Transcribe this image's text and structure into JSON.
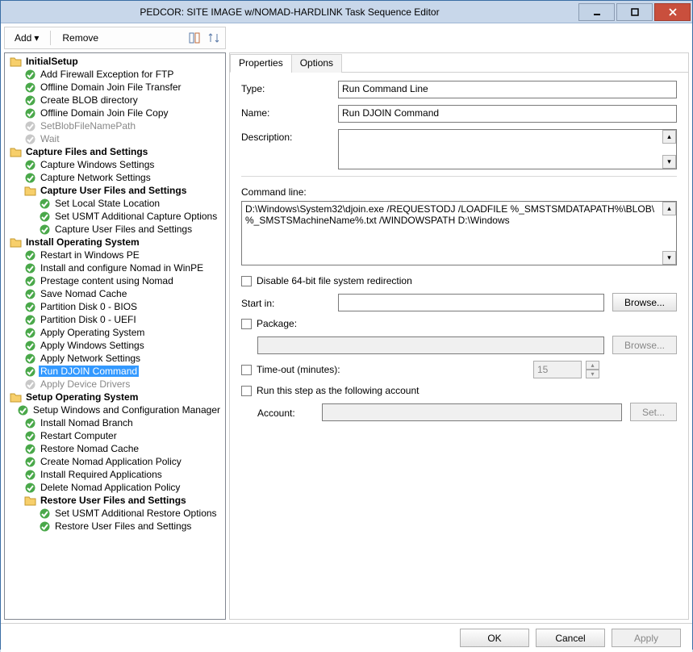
{
  "title": "PEDCOR: SITE IMAGE w/NOMAD-HARDLINK Task Sequence Editor",
  "toolbar": {
    "add": "Add",
    "remove": "Remove"
  },
  "tabs": {
    "properties": "Properties",
    "options": "Options"
  },
  "labels": {
    "type": "Type:",
    "name": "Name:",
    "description": "Description:",
    "cmdline": "Command line:",
    "disable64": "Disable 64-bit file system redirection",
    "startin": "Start in:",
    "package": "Package:",
    "timeout": "Time-out (minutes):",
    "runas": "Run this step as the following account",
    "account": "Account:",
    "browse": "Browse...",
    "set": "Set...",
    "ok": "OK",
    "cancel": "Cancel",
    "apply": "Apply"
  },
  "values": {
    "type": "Run Command Line",
    "name": "Run DJOIN Command",
    "description": "",
    "cmdline": "D:\\Windows\\System32\\djoin.exe /REQUESTODJ /LOADFILE %_SMSTSMDATAPATH%\\BLOB\\%_SMSTSMachineName%.txt /WINDOWSPATH D:\\Windows",
    "startin": "",
    "package": "",
    "timeout": "15",
    "account": ""
  },
  "tree": [
    {
      "d": 0,
      "t": "folder",
      "b": 1,
      "l": "InitialSetup"
    },
    {
      "d": 1,
      "t": "ok",
      "l": "Add Firewall Exception for FTP"
    },
    {
      "d": 1,
      "t": "ok",
      "l": "Offline Domain Join File Transfer"
    },
    {
      "d": 1,
      "t": "ok",
      "l": "Create BLOB directory"
    },
    {
      "d": 1,
      "t": "ok",
      "l": "Offline Domain Join File Copy"
    },
    {
      "d": 1,
      "t": "dis",
      "g": 1,
      "l": "SetBlobFileNamePath"
    },
    {
      "d": 1,
      "t": "dis",
      "g": 1,
      "l": "Wait"
    },
    {
      "d": 0,
      "t": "folder",
      "b": 1,
      "l": "Capture Files and Settings"
    },
    {
      "d": 1,
      "t": "ok",
      "l": "Capture Windows Settings"
    },
    {
      "d": 1,
      "t": "ok",
      "l": "Capture Network Settings"
    },
    {
      "d": 1,
      "t": "folder",
      "b": 1,
      "l": "Capture User Files and Settings"
    },
    {
      "d": 2,
      "t": "ok",
      "l": "Set Local State Location"
    },
    {
      "d": 2,
      "t": "ok",
      "l": "Set USMT Additional Capture Options"
    },
    {
      "d": 2,
      "t": "ok",
      "l": "Capture User Files and Settings"
    },
    {
      "d": 0,
      "t": "folder",
      "b": 1,
      "l": "Install Operating System"
    },
    {
      "d": 1,
      "t": "ok",
      "l": "Restart in Windows PE"
    },
    {
      "d": 1,
      "t": "ok",
      "l": "Install and configure Nomad in WinPE"
    },
    {
      "d": 1,
      "t": "ok",
      "l": "Prestage content using Nomad"
    },
    {
      "d": 1,
      "t": "ok",
      "l": "Save Nomad Cache"
    },
    {
      "d": 1,
      "t": "ok",
      "l": "Partition Disk 0 - BIOS"
    },
    {
      "d": 1,
      "t": "ok",
      "l": "Partition Disk 0 - UEFI"
    },
    {
      "d": 1,
      "t": "ok",
      "l": "Apply Operating System"
    },
    {
      "d": 1,
      "t": "ok",
      "l": "Apply Windows Settings"
    },
    {
      "d": 1,
      "t": "ok",
      "l": "Apply Network Settings"
    },
    {
      "d": 1,
      "t": "ok",
      "sel": 1,
      "l": "Run DJOIN Command"
    },
    {
      "d": 1,
      "t": "dis",
      "g": 1,
      "l": "Apply Device Drivers"
    },
    {
      "d": 0,
      "t": "folder",
      "b": 1,
      "l": "Setup Operating System"
    },
    {
      "d": 1,
      "t": "ok",
      "l": "Setup Windows and Configuration Manager"
    },
    {
      "d": 1,
      "t": "ok",
      "l": "Install Nomad Branch"
    },
    {
      "d": 1,
      "t": "ok",
      "l": "Restart Computer"
    },
    {
      "d": 1,
      "t": "ok",
      "l": "Restore Nomad Cache"
    },
    {
      "d": 1,
      "t": "ok",
      "l": "Create Nomad Application Policy"
    },
    {
      "d": 1,
      "t": "ok",
      "l": "Install Required Applications"
    },
    {
      "d": 1,
      "t": "ok",
      "l": "Delete Nomad Application Policy"
    },
    {
      "d": 1,
      "t": "folder",
      "b": 1,
      "l": "Restore User Files and Settings"
    },
    {
      "d": 2,
      "t": "ok",
      "l": "Set USMT Additional Restore Options"
    },
    {
      "d": 2,
      "t": "ok",
      "l": "Restore User Files and Settings"
    }
  ]
}
